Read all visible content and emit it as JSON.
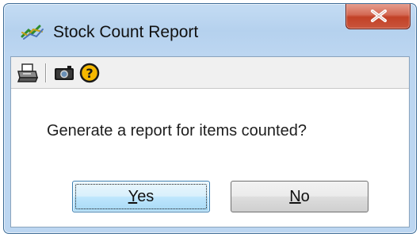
{
  "window": {
    "title": "Stock Count Report",
    "app_icon": "stock-count-app-icon",
    "close_icon": "close-icon"
  },
  "toolbar": {
    "items": [
      {
        "name": "print-icon"
      },
      {
        "name": "camera-icon"
      },
      {
        "name": "help-icon"
      }
    ]
  },
  "dialog": {
    "message": "Generate a report for items counted?",
    "buttons": {
      "yes_accel": "Y",
      "yes_rest": "es",
      "no_accel": "N",
      "no_rest": "o"
    }
  },
  "colors": {
    "title_bar": "#bcd6f1",
    "close_button": "#c24127",
    "focused_button_border": "#3c7fb1",
    "help_icon_fill": "#f5b800"
  }
}
